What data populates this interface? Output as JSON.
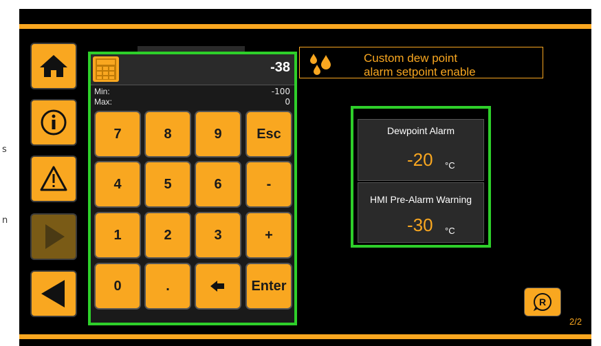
{
  "left_margin_text": [
    "s",
    "n"
  ],
  "sidebar": {
    "items": [
      {
        "name": "home",
        "icon": "home-icon"
      },
      {
        "name": "info",
        "icon": "info-icon"
      },
      {
        "name": "warning",
        "icon": "warning-icon"
      },
      {
        "name": "forward",
        "icon": "play-icon"
      },
      {
        "name": "back",
        "icon": "back-icon"
      }
    ]
  },
  "keypad": {
    "value": "-38",
    "min_label": "Min:",
    "min_value": "-100",
    "max_label": "Max:",
    "max_value": "0",
    "keys": [
      "7",
      "8",
      "9",
      "Esc",
      "4",
      "5",
      "6",
      "-",
      "1",
      "2",
      "3",
      "+",
      "0",
      ".",
      "",
      "Enter"
    ],
    "backspace_icon": "backspace-arrow-icon"
  },
  "help": {
    "icon": "water-drops-icon",
    "line1": "Custom dew point",
    "line2": "alarm setpoint enable"
  },
  "alarms": {
    "dewpoint": {
      "title": "Dewpoint Alarm",
      "value": "-20",
      "unit": "°C"
    },
    "prealarm": {
      "title": "HMI Pre-Alarm Warning",
      "value": "-30",
      "unit": "°C"
    }
  },
  "reset": {
    "label": "R"
  },
  "page_indicator": "2/2",
  "colors": {
    "accent": "#f9a720",
    "highlight": "#2ecf2a",
    "background": "#000000"
  }
}
